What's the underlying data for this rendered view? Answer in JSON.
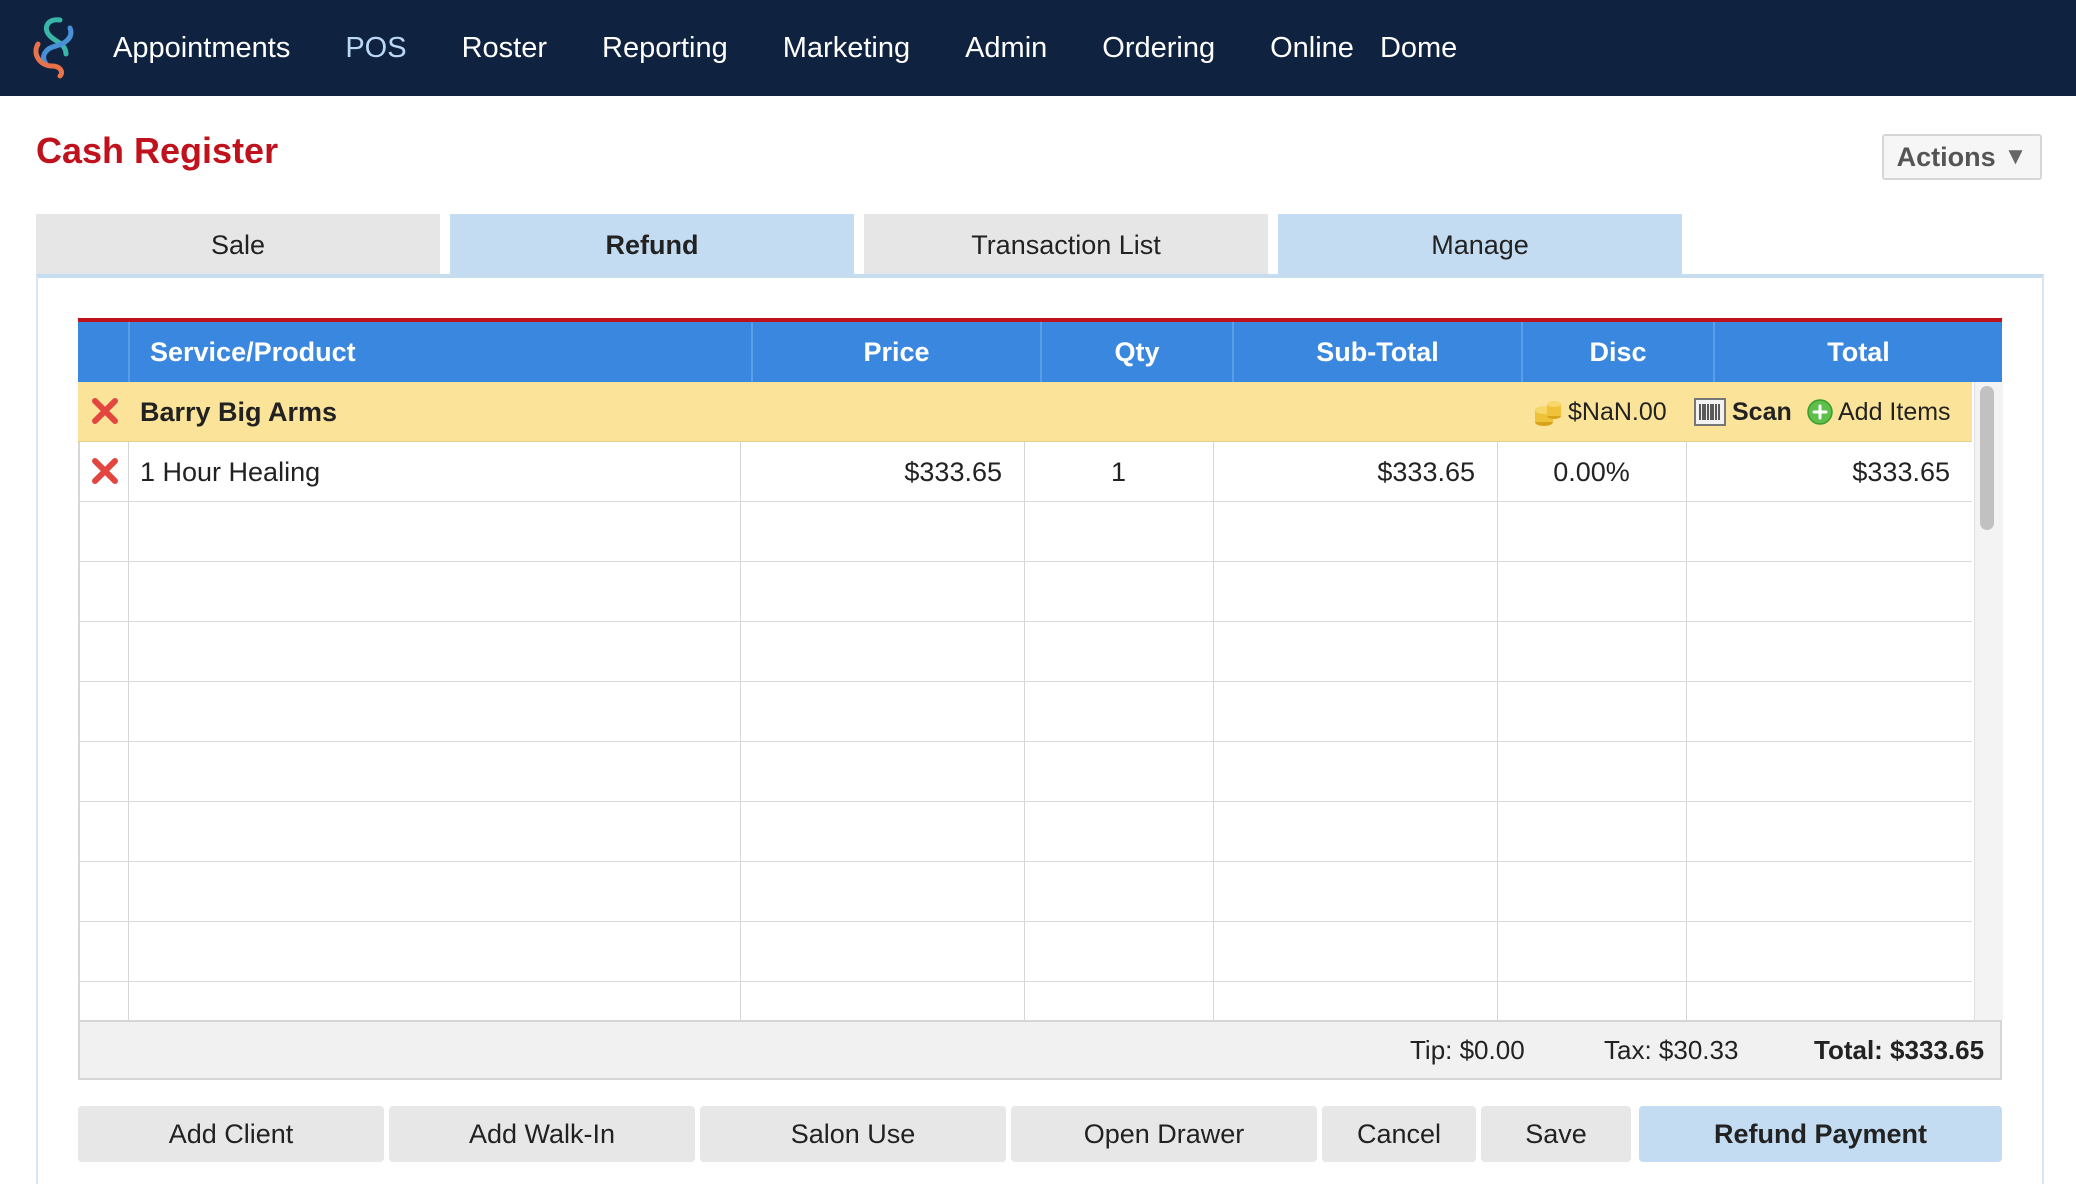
{
  "nav": {
    "items": [
      "Appointments",
      "POS",
      "Roster",
      "Reporting",
      "Marketing",
      "Admin",
      "Ordering",
      "Online",
      "Dome"
    ],
    "active_index": 1
  },
  "page": {
    "title": "Cash Register",
    "actions_label": "Actions"
  },
  "tabs": [
    {
      "label": "Sale"
    },
    {
      "label": "Refund"
    },
    {
      "label": "Transaction List"
    },
    {
      "label": "Manage"
    }
  ],
  "table": {
    "headers": {
      "service": "Service/Product",
      "price": "Price",
      "qty": "Qty",
      "subtotal": "Sub-Total",
      "disc": "Disc",
      "total": "Total"
    },
    "client": {
      "name": "Barry Big Arms",
      "balance": "$NaN.00",
      "scan_label": "Scan",
      "add_items_label": "Add Items"
    },
    "rows": [
      {
        "service": "1 Hour Healing",
        "price": "$333.65",
        "qty": "1",
        "subtotal": "$333.65",
        "disc": "0.00%",
        "total": "$333.65"
      }
    ]
  },
  "summary": {
    "tip": "Tip: $0.00",
    "tax": "Tax: $30.33",
    "total": "Total: $333.65"
  },
  "buttons": {
    "add_client": "Add Client",
    "add_walkin": "Add Walk-In",
    "salon_use": "Salon Use",
    "open_drawer": "Open Drawer",
    "cancel": "Cancel",
    "save": "Save",
    "refund_payment": "Refund Payment"
  },
  "colors": {
    "nav_bg": "#0f2340",
    "title_red": "#c0121d",
    "header_blue": "#3a87df",
    "client_row": "#fbe49a",
    "tab_light_blue": "#c3dcf1"
  }
}
